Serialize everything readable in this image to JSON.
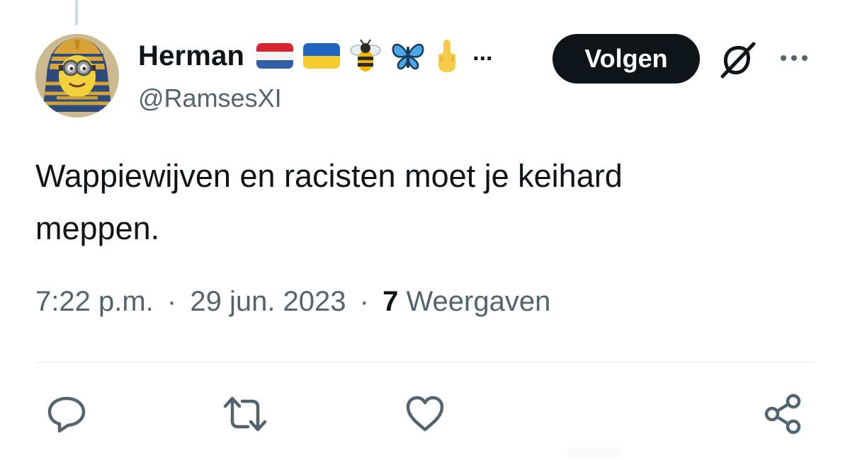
{
  "author": {
    "display_name": "Herman",
    "name_overflow": "...",
    "handle": "@RamsesXI",
    "name_emojis": [
      "flag-netherlands-emoji",
      "flag-ukraine-emoji",
      "bee-emoji",
      "butterfly-emoji",
      "middle-finger-emoji"
    ]
  },
  "header_actions": {
    "follow_label": "Volgen",
    "grok_icon": "grok-icon",
    "more_icon": "more-horizontal-icon"
  },
  "tweet": {
    "text_line_1": "Wappiewijven en racisten moet je keihard",
    "text_line_2": "meppen.",
    "time": "7:22 p.m.",
    "separator": "·",
    "date": "29 jun. 2023",
    "views_count": "7",
    "views_label": "Weergaven"
  },
  "actions": [
    {
      "name": "reply",
      "icon": "reply-bubble-icon"
    },
    {
      "name": "retweet",
      "icon": "retweet-icon"
    },
    {
      "name": "like",
      "icon": "heart-icon"
    },
    {
      "name": "share",
      "icon": "share-icon"
    }
  ],
  "colors": {
    "text_primary": "#0f1419",
    "text_secondary": "#536471",
    "follow_bg": "#0f1419",
    "follow_text": "#ffffff",
    "divider": "#eff3f4",
    "icon_gray": "#536471"
  }
}
